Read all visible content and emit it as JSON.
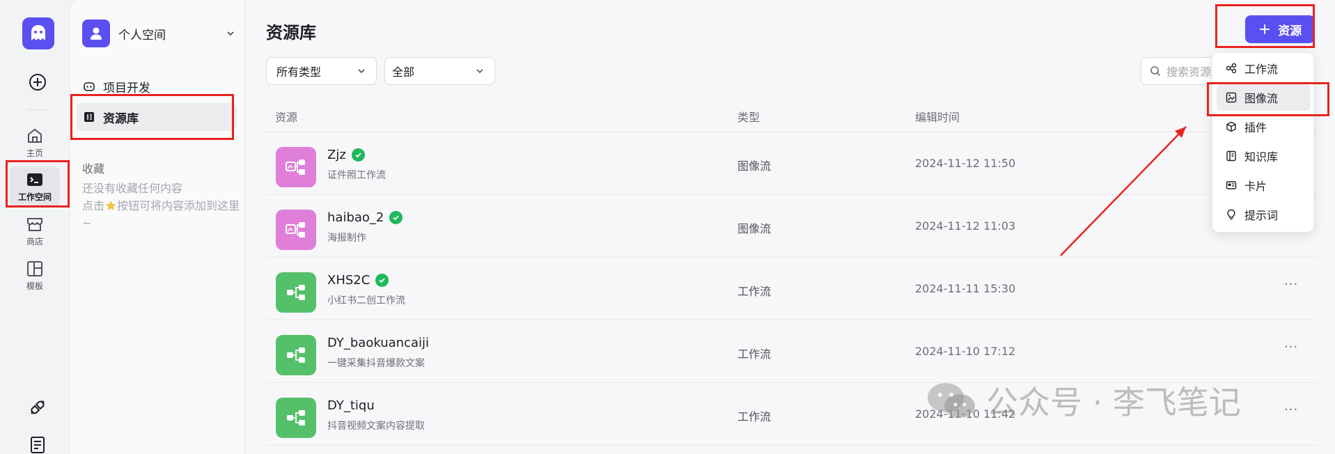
{
  "rail": {
    "items": [
      {
        "label": "主页",
        "icon": "home-icon"
      },
      {
        "label": "工作空间",
        "icon": "terminal-icon"
      },
      {
        "label": "商店",
        "icon": "store-icon"
      },
      {
        "label": "模板",
        "icon": "template-icon"
      }
    ]
  },
  "sidebar": {
    "space_name": "个人空间",
    "nav": [
      {
        "label": "项目开发",
        "icon": "bot-icon"
      },
      {
        "label": "资源库",
        "icon": "library-icon"
      }
    ],
    "favorites_title": "收藏",
    "favorites_empty_1": "还没有收藏任何内容",
    "favorites_empty_2_pre": "点击",
    "favorites_empty_2_post": "按钮可将内容添加到这里~"
  },
  "main": {
    "title": "资源库",
    "add_button": "资源",
    "filter_type": "所有类型",
    "filter_scope": "全部",
    "search_placeholder": "搜索资源",
    "columns": {
      "resource": "资源",
      "type": "类型",
      "edited": "编辑时间"
    },
    "rows": [
      {
        "name": "Zjz",
        "desc": "证件照工作流",
        "type": "图像流",
        "time": "2024-11-12 11:50",
        "verified": true,
        "icon_color": "#df7fd9"
      },
      {
        "name": "haibao_2",
        "desc": "海报制作",
        "type": "图像流",
        "time": "2024-11-12 11:03",
        "verified": true,
        "icon_color": "#df7fd9"
      },
      {
        "name": "XHS2C",
        "desc": "小红书二创工作流",
        "type": "工作流",
        "time": "2024-11-11 15:30",
        "verified": true,
        "icon_color": "#55c06a",
        "more": "···"
      },
      {
        "name": "DY_baokuancaiji",
        "desc": "一键采集抖音爆款文案",
        "type": "工作流",
        "time": "2024-11-10 17:12",
        "verified": false,
        "icon_color": "#55c06a",
        "more": "···"
      },
      {
        "name": "DY_tiqu",
        "desc": "抖音视频文案内容提取",
        "type": "工作流",
        "time": "2024-11-10 11:42",
        "verified": false,
        "icon_color": "#55c06a",
        "more": "···"
      }
    ]
  },
  "dropdown": {
    "items": [
      {
        "label": "工作流",
        "icon": "workflow-icon"
      },
      {
        "label": "图像流",
        "icon": "imageflow-icon"
      },
      {
        "label": "插件",
        "icon": "cube-icon"
      },
      {
        "label": "知识库",
        "icon": "knowledge-icon"
      },
      {
        "label": "卡片",
        "icon": "card-icon"
      },
      {
        "label": "提示词",
        "icon": "bulb-icon"
      }
    ]
  },
  "watermark": "公众号 · 李飞笔记",
  "colors": {
    "accent": "#5a4ff0",
    "annotation": "#e8231f",
    "imageflow": "#df7fd9",
    "workflow": "#55c06a",
    "verified": "#1fb85a"
  }
}
